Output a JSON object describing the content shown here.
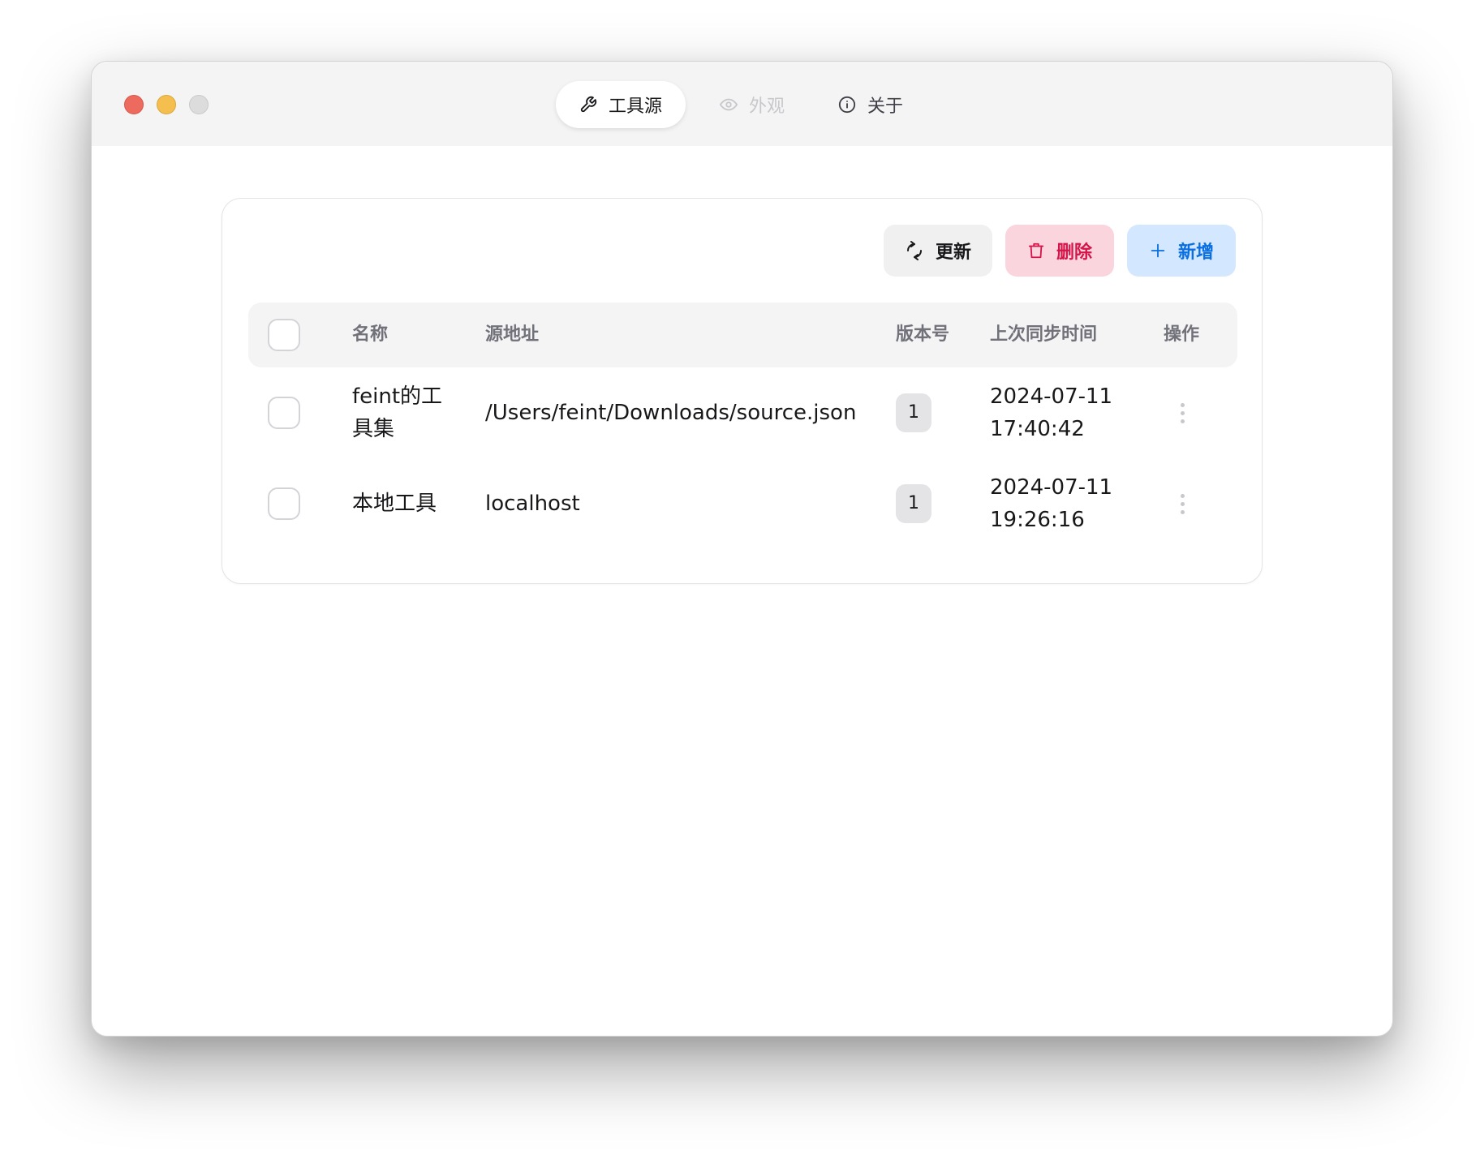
{
  "window": {
    "traffic_lights": [
      "close",
      "minimize",
      "zoom"
    ]
  },
  "tabs": [
    {
      "label": "工具源",
      "icon": "wrench-icon",
      "state": "active"
    },
    {
      "label": "外观",
      "icon": "eye-icon",
      "state": "disabled"
    },
    {
      "label": "关于",
      "icon": "info-icon",
      "state": "normal"
    }
  ],
  "toolbar": {
    "update_label": "更新",
    "delete_label": "删除",
    "add_label": "新增"
  },
  "colors": {
    "delete_text": "#d3154a",
    "delete_bg": "#fbd5dd",
    "add_text": "#0a6fe0",
    "add_bg": "#d3e7ff"
  },
  "table": {
    "columns": {
      "name": "名称",
      "source": "源地址",
      "version": "版本号",
      "synced": "上次同步时间",
      "actions": "操作"
    },
    "rows": [
      {
        "name_line1": "feint的工",
        "name_line2": "具集",
        "source": "/Users/feint/Downloads/source.json",
        "version": "1",
        "synced_date": "2024-07-11",
        "synced_time": "17:40:42"
      },
      {
        "name_line1": "本地工具",
        "name_line2": "",
        "source": "localhost",
        "version": "1",
        "synced_date": "2024-07-11",
        "synced_time": "19:26:16"
      }
    ]
  }
}
